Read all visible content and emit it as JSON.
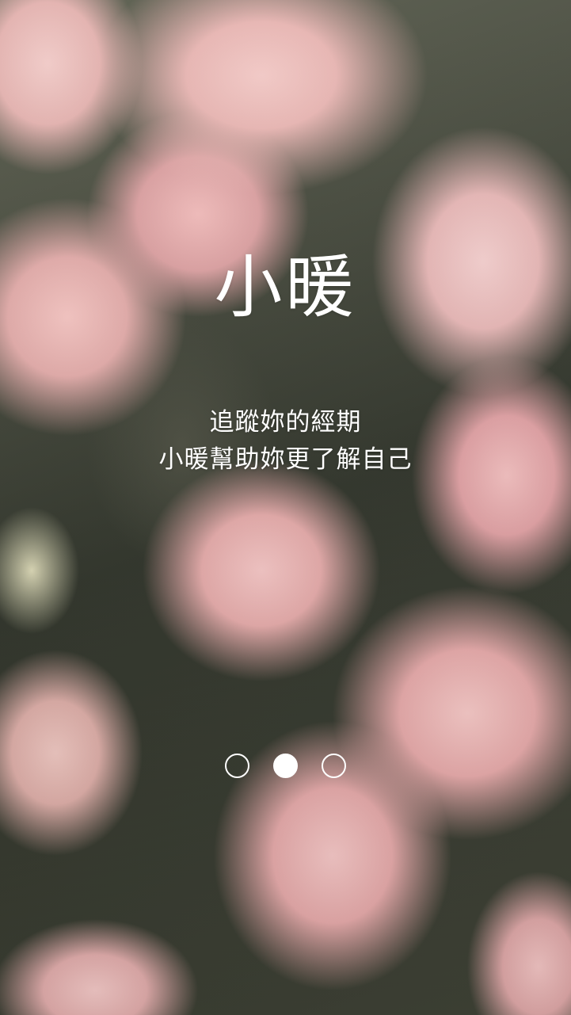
{
  "splash": {
    "app_name": "小暖",
    "tagline_line1": "追蹤妳的經期",
    "tagline_line2": "小暖幫助妳更了解自己"
  },
  "pager": {
    "total_pages": 3,
    "active_index": 1
  },
  "colors": {
    "text": "#ffffff",
    "dot": "#ffffff"
  }
}
